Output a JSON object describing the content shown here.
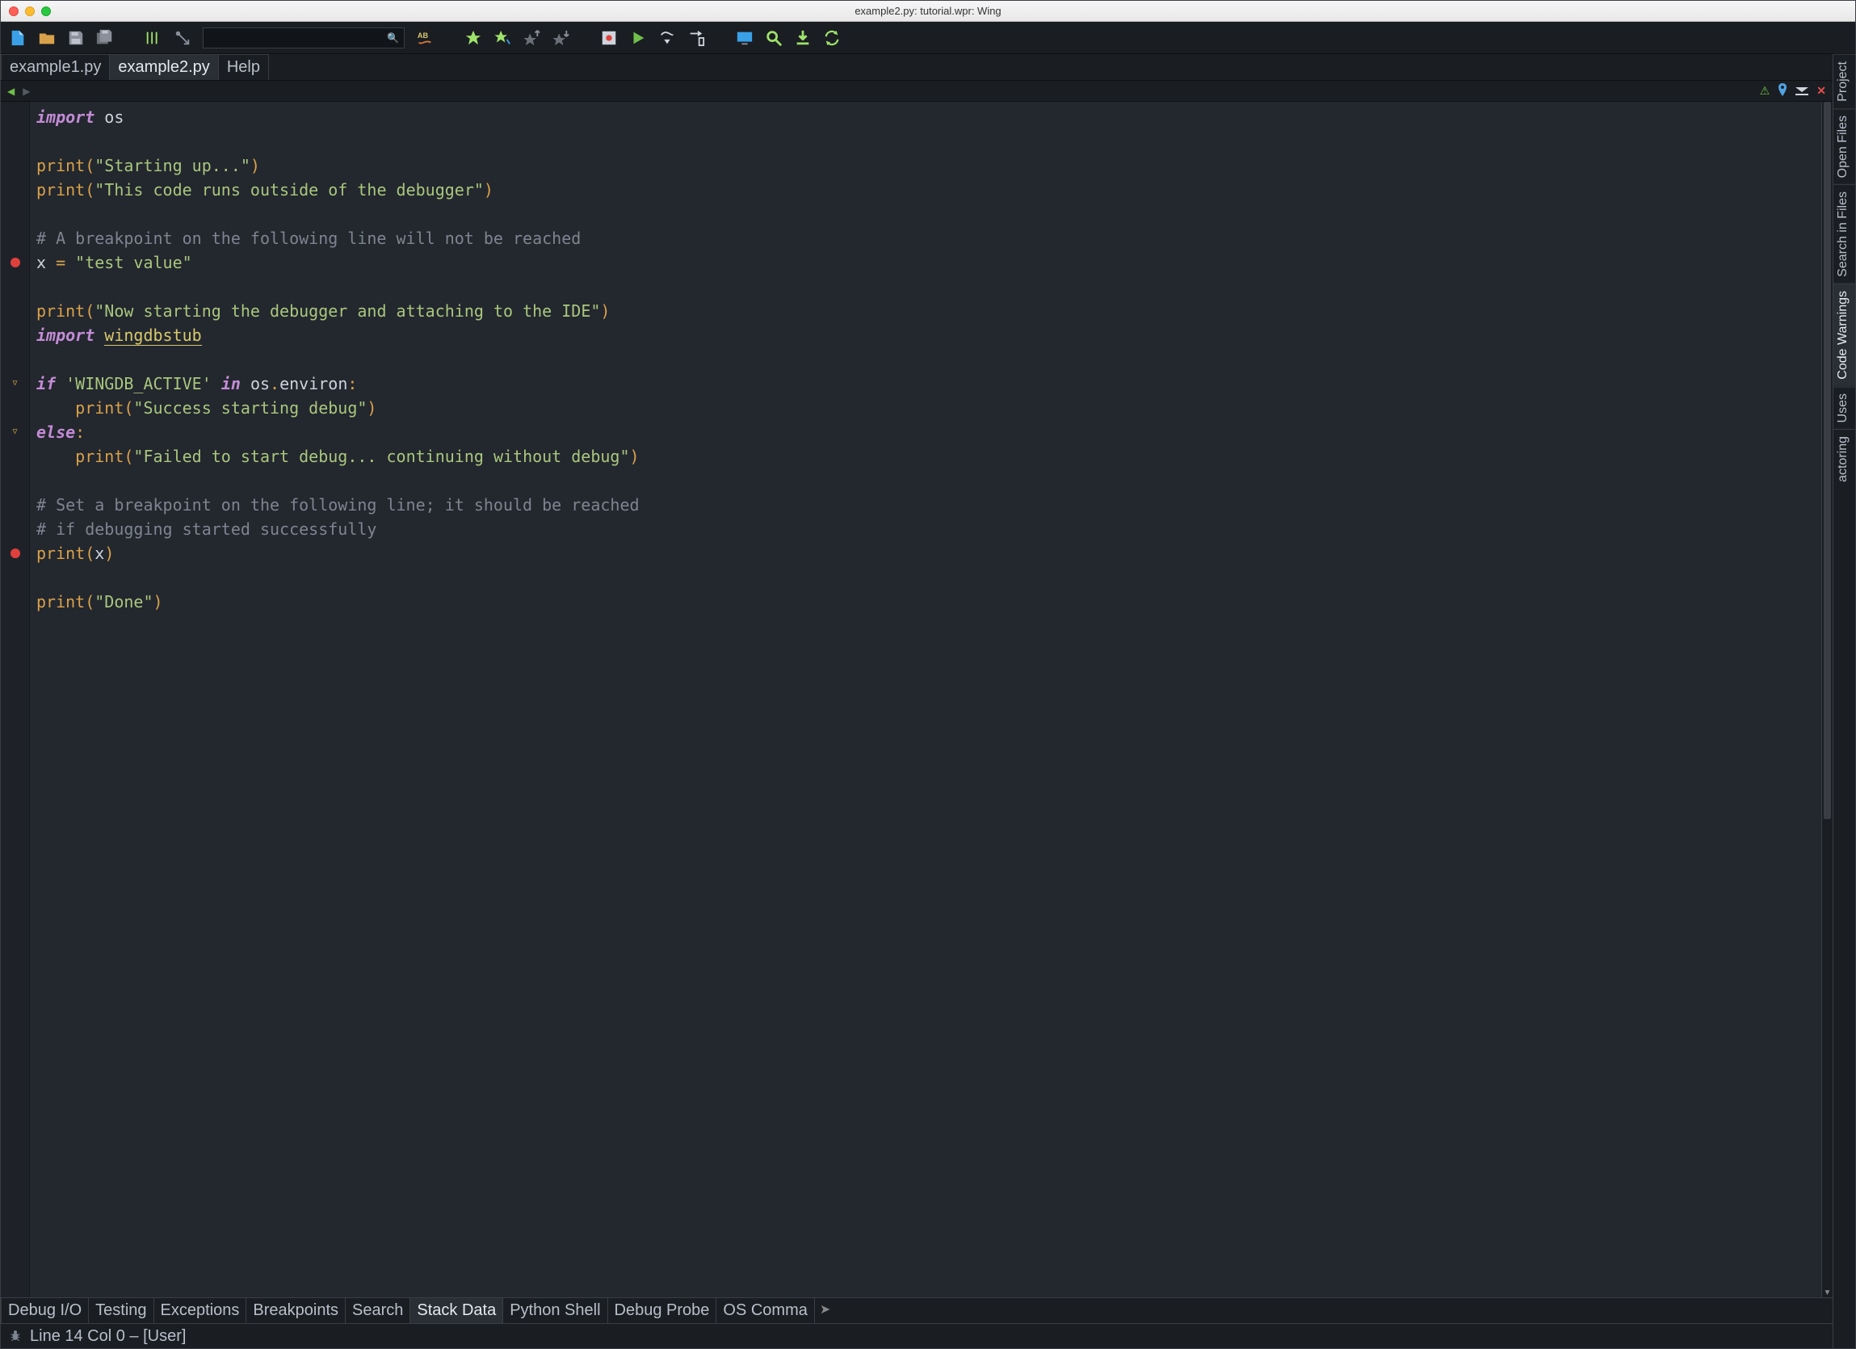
{
  "window": {
    "title": "example2.py: tutorial.wpr: Wing"
  },
  "file_tabs": {
    "items": [
      {
        "label": "example1.py",
        "active": false
      },
      {
        "label": "example2.py",
        "active": true
      },
      {
        "label": "Help",
        "active": false
      }
    ]
  },
  "code": {
    "lines": [
      {
        "gutter": "",
        "html": "<span class='kw'>import</span> <span class='id'>os</span>"
      },
      {
        "gutter": "",
        "html": ""
      },
      {
        "gutter": "",
        "html": "<span class='fn'>print</span><span class='pn'>(</span><span class='str'>\"Starting up...\"</span><span class='pn'>)</span>"
      },
      {
        "gutter": "",
        "html": "<span class='fn'>print</span><span class='pn'>(</span><span class='str'>\"This code runs outside of the debugger\"</span><span class='pn'>)</span>"
      },
      {
        "gutter": "",
        "html": ""
      },
      {
        "gutter": "",
        "html": "<span class='cmt'># A breakpoint on the following line will not be reached</span>"
      },
      {
        "gutter": "bp",
        "html": "<span class='id'>x </span><span class='pn'>=</span><span class='str'> \"test value\"</span>"
      },
      {
        "gutter": "",
        "html": ""
      },
      {
        "gutter": "",
        "html": "<span class='fn'>print</span><span class='pn'>(</span><span class='str'>\"Now starting the debugger and attaching to the IDE\"</span><span class='pn'>)</span>"
      },
      {
        "gutter": "",
        "html": "<span class='kw'>import</span> <span class='mod'>wingdbstub</span>"
      },
      {
        "gutter": "",
        "html": ""
      },
      {
        "gutter": "fold",
        "html": "<span class='kw'>if</span> <span class='str'>'WINGDB_ACTIVE'</span> <span class='kw'>in</span> <span class='id'>os</span><span class='pn'>.</span><span class='id'>environ</span><span class='pn'>:</span>"
      },
      {
        "gutter": "",
        "html": "<span class='indent4'><span class='fn'>print</span><span class='pn'>(</span><span class='str'>\"Success starting debug\"</span><span class='pn'>)</span></span>"
      },
      {
        "gutter": "fold",
        "html": "<span class='kw'>else</span><span class='pn'>:</span>"
      },
      {
        "gutter": "",
        "html": "<span class='indent4'><span class='fn'>print</span><span class='pn'>(</span><span class='str'>\"Failed to start debug... continuing without debug\"</span><span class='pn'>)</span></span>"
      },
      {
        "gutter": "",
        "html": ""
      },
      {
        "gutter": "",
        "html": "<span class='cmt'># Set a breakpoint on the following line; it should be reached</span>"
      },
      {
        "gutter": "",
        "html": "<span class='cmt'># if debugging started successfully</span>"
      },
      {
        "gutter": "bp",
        "html": "<span class='fn'>print</span><span class='pn'>(</span><span class='id'>x</span><span class='pn'>)</span>"
      },
      {
        "gutter": "",
        "html": ""
      },
      {
        "gutter": "",
        "html": "<span class='fn'>print</span><span class='pn'>(</span><span class='str'>\"Done\"</span><span class='pn'>)</span>"
      },
      {
        "gutter": "",
        "html": ""
      },
      {
        "gutter": "",
        "html": ""
      }
    ]
  },
  "side_tabs": {
    "items": [
      {
        "label": "Project",
        "active": false
      },
      {
        "label": "Open Files",
        "active": false
      },
      {
        "label": "Search in Files",
        "active": false
      },
      {
        "label": "Code Warnings",
        "active": true
      },
      {
        "label": "Uses",
        "active": false
      },
      {
        "label": "actoring",
        "active": false
      }
    ]
  },
  "bottom_tabs": {
    "items": [
      {
        "label": "Debug I/O",
        "active": false
      },
      {
        "label": "Testing",
        "active": false
      },
      {
        "label": "Exceptions",
        "active": false
      },
      {
        "label": "Breakpoints",
        "active": false
      },
      {
        "label": "Search",
        "active": false
      },
      {
        "label": "Stack Data",
        "active": true
      },
      {
        "label": "Python Shell",
        "active": false
      },
      {
        "label": "Debug Probe",
        "active": false
      },
      {
        "label": "OS Comma",
        "active": false
      }
    ]
  },
  "status": {
    "text": "Line 14 Col 0 – [User]"
  },
  "nav_icons": {
    "warn": "▲",
    "pin": "📍",
    "chev": "❱",
    "close": "✕"
  }
}
